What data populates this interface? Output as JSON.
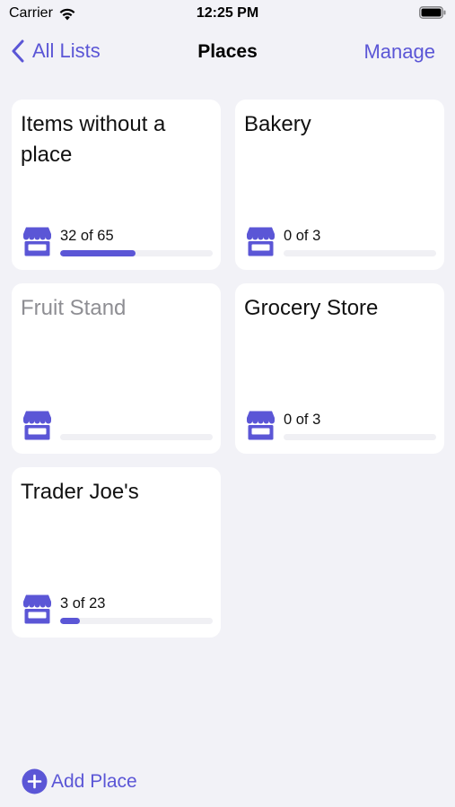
{
  "status_bar": {
    "carrier": "Carrier",
    "time": "12:25 PM"
  },
  "nav": {
    "back_label": "All Lists",
    "title": "Places",
    "action_label": "Manage"
  },
  "colors": {
    "accent": "#5b56d6",
    "background": "#f2f2f7",
    "card": "#ffffff",
    "dim_text": "#8e8e93"
  },
  "places": [
    {
      "name": "Items without a place",
      "count_text": "32 of 65",
      "done": 32,
      "total": 65,
      "dimmed": false
    },
    {
      "name": "Bakery",
      "count_text": "0 of 3",
      "done": 0,
      "total": 3,
      "dimmed": false
    },
    {
      "name": "Fruit Stand",
      "count_text": "",
      "done": 0,
      "total": 0,
      "dimmed": true
    },
    {
      "name": "Grocery Store",
      "count_text": "0 of 3",
      "done": 0,
      "total": 3,
      "dimmed": false
    },
    {
      "name": "Trader Joe's",
      "count_text": "3 of 23",
      "done": 3,
      "total": 23,
      "dimmed": false
    }
  ],
  "toolbar": {
    "add_label": "Add Place",
    "add_icon": "plus-circle-icon"
  },
  "icons": {
    "place_icon": "store-icon"
  }
}
